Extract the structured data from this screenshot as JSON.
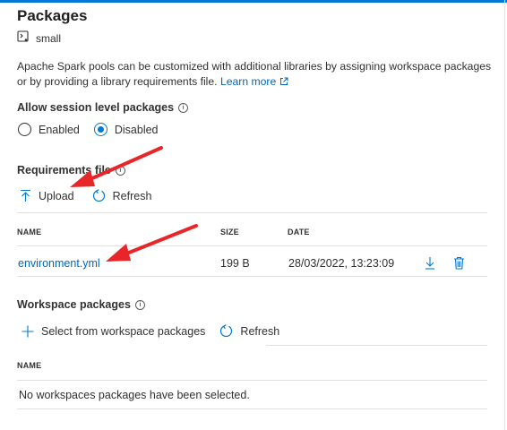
{
  "header": {
    "title": "Packages",
    "pool_name": "small"
  },
  "description": {
    "text": "Apache Spark pools can be customized with additional libraries by assigning workspace packages or by providing a library requirements file.",
    "link_label": "Learn more"
  },
  "session": {
    "label": "Allow session level packages",
    "options": [
      "Enabled",
      "Disabled"
    ],
    "selected": "Disabled"
  },
  "requirements": {
    "label": "Requirements file",
    "upload_label": "Upload",
    "refresh_label": "Refresh",
    "columns": [
      "NAME",
      "SIZE",
      "DATE"
    ],
    "rows": [
      {
        "name": "environment.yml",
        "size": "199 B",
        "date": "28/03/2022, 13:23:09"
      }
    ]
  },
  "workspace": {
    "label": "Workspace packages",
    "select_label": "Select from workspace packages",
    "refresh_label": "Refresh",
    "column": "NAME",
    "empty_text": "No workspaces packages have been selected."
  },
  "colors": {
    "accent": "#0078d4",
    "link": "#0067b8",
    "annotation_arrow": "#e8262a"
  },
  "icons": [
    "spark-pool-icon",
    "external-link-icon",
    "info-icon",
    "upload-icon",
    "refresh-icon",
    "download-icon",
    "delete-icon",
    "add-icon"
  ]
}
